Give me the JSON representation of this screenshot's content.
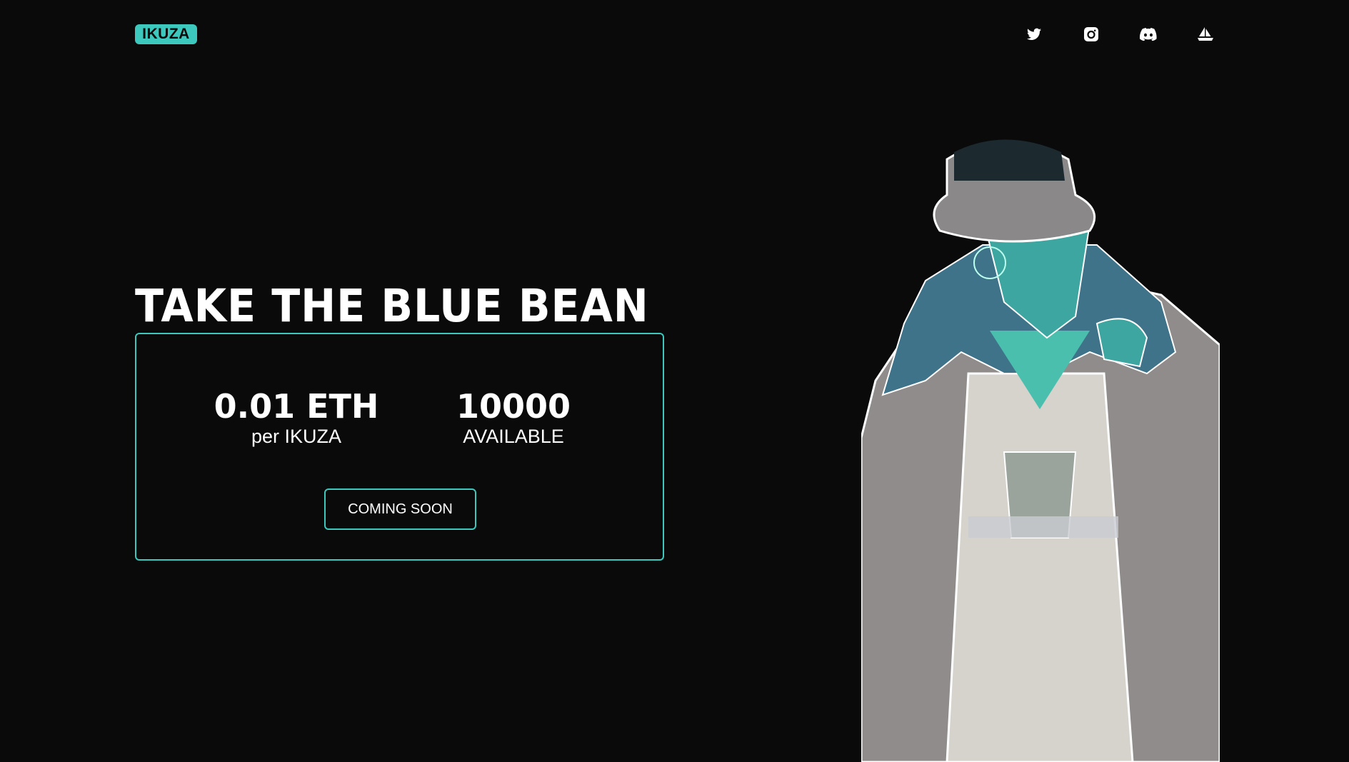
{
  "header": {
    "logo": "IKUZA",
    "social": [
      {
        "icon": "twitter-icon"
      },
      {
        "icon": "instagram-icon"
      },
      {
        "icon": "discord-icon"
      },
      {
        "icon": "opensea-icon"
      }
    ]
  },
  "hero": {
    "title": "TAKE THE BLUE BEAN",
    "price_value": "0.01 ETH",
    "price_label": "per IKUZA",
    "supply_value": "10000",
    "supply_label": "AVAILABLE",
    "button_label": "COMING SOON"
  },
  "colors": {
    "accent": "#3cc8bd",
    "background": "#0a0a0a"
  }
}
